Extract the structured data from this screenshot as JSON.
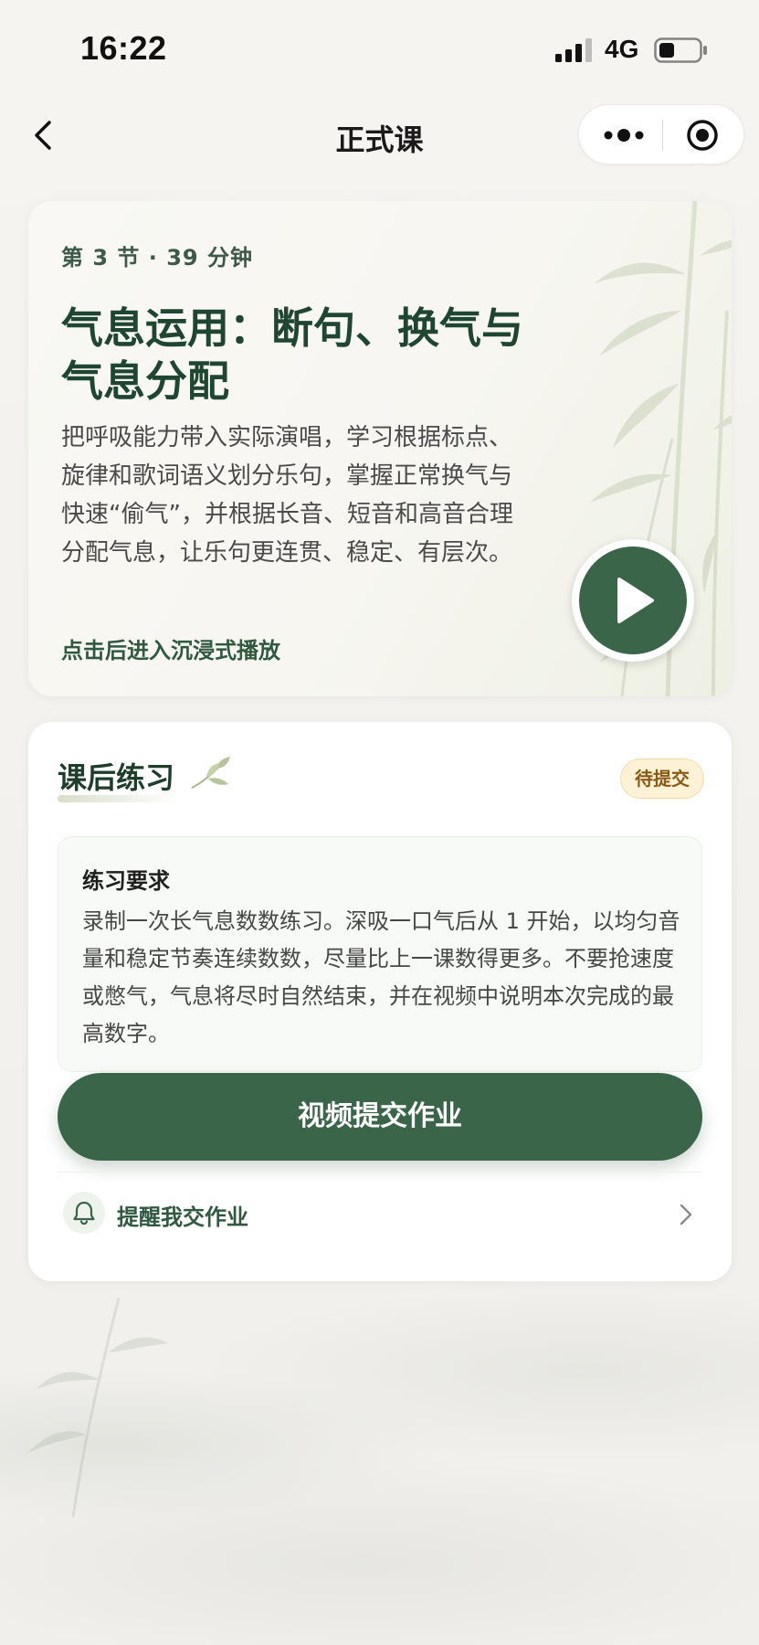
{
  "status_bar": {
    "time": "16:22",
    "network": "4G"
  },
  "nav": {
    "title": "正式课"
  },
  "lesson": {
    "meta": "第 3 节 · 39 分钟",
    "title": "气息运用：断句、换气与气息分配",
    "description": "把呼吸能力带入实际演唱，学习根据标点、旋律和歌词语义划分乐句，掌握正常换气与快速“偷气”，并根据长音、短音和高音合理分配气息，让乐句更连贯、稳定、有层次。",
    "hint": "点击后进入沉浸式播放"
  },
  "practice": {
    "title": "课后练习",
    "badge": "待提交",
    "requirement_title": "练习要求",
    "requirement_text": "录制一次长气息数数练习。深吸一口气后从 1 开始，以均匀音量和稳定节奏连续数数，尽量比上一课数得更多。不要抢速度或憋气，气息将尽时自然结束，并在视频中说明本次完成的最高数字。",
    "submit_label": "视频提交作业",
    "remind_label": "提醒我交作业"
  },
  "colors": {
    "accent": "#3a6548",
    "title_green": "#1e4630",
    "badge_bg": "#fdf1d6",
    "badge_text": "#8a5a14"
  },
  "icons": [
    "back-icon",
    "more-icon",
    "target-icon",
    "play-icon",
    "leaf-icon",
    "bell-icon",
    "chevron-right-icon",
    "signal-icon",
    "battery-icon"
  ]
}
